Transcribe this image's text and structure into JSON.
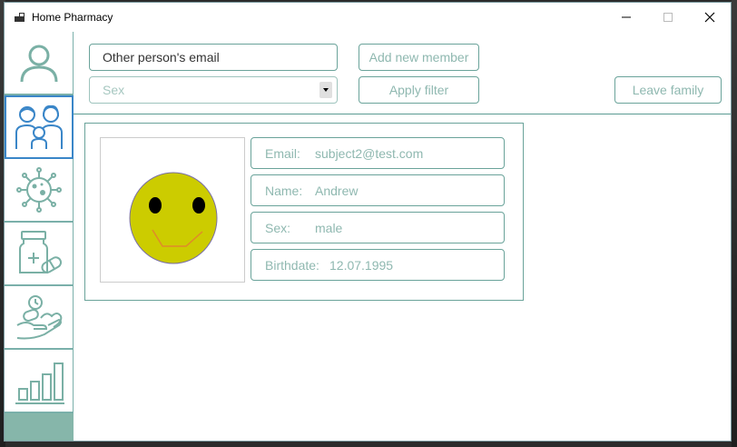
{
  "window": {
    "title": "Home Pharmacy"
  },
  "sidebar": {
    "items": [
      {
        "name": "profile",
        "icon": "user-icon"
      },
      {
        "name": "family",
        "icon": "family-icon",
        "active": true
      },
      {
        "name": "virus",
        "icon": "virus-icon"
      },
      {
        "name": "medicine",
        "icon": "medicine-bottle-icon"
      },
      {
        "name": "care",
        "icon": "hand-care-icon"
      },
      {
        "name": "statistics",
        "icon": "bar-chart-icon"
      }
    ]
  },
  "toolbar": {
    "email_placeholder": "Other person's email",
    "add_member_label": "Add new member",
    "sex_placeholder": "Sex",
    "apply_filter_label": "Apply filter",
    "leave_family_label": "Leave family"
  },
  "member": {
    "email_label": "Email:",
    "email_value": "subject2@test.com",
    "name_label": "Name:",
    "name_value": "Andrew",
    "sex_label": "Sex:",
    "sex_value": "male",
    "birthdate_label": "Birthdate:",
    "birthdate_value": "12.07.1995"
  },
  "colors": {
    "accent": "#6aa39a",
    "active_nav": "#3a86c8",
    "smiley_face": "#cccc00"
  }
}
